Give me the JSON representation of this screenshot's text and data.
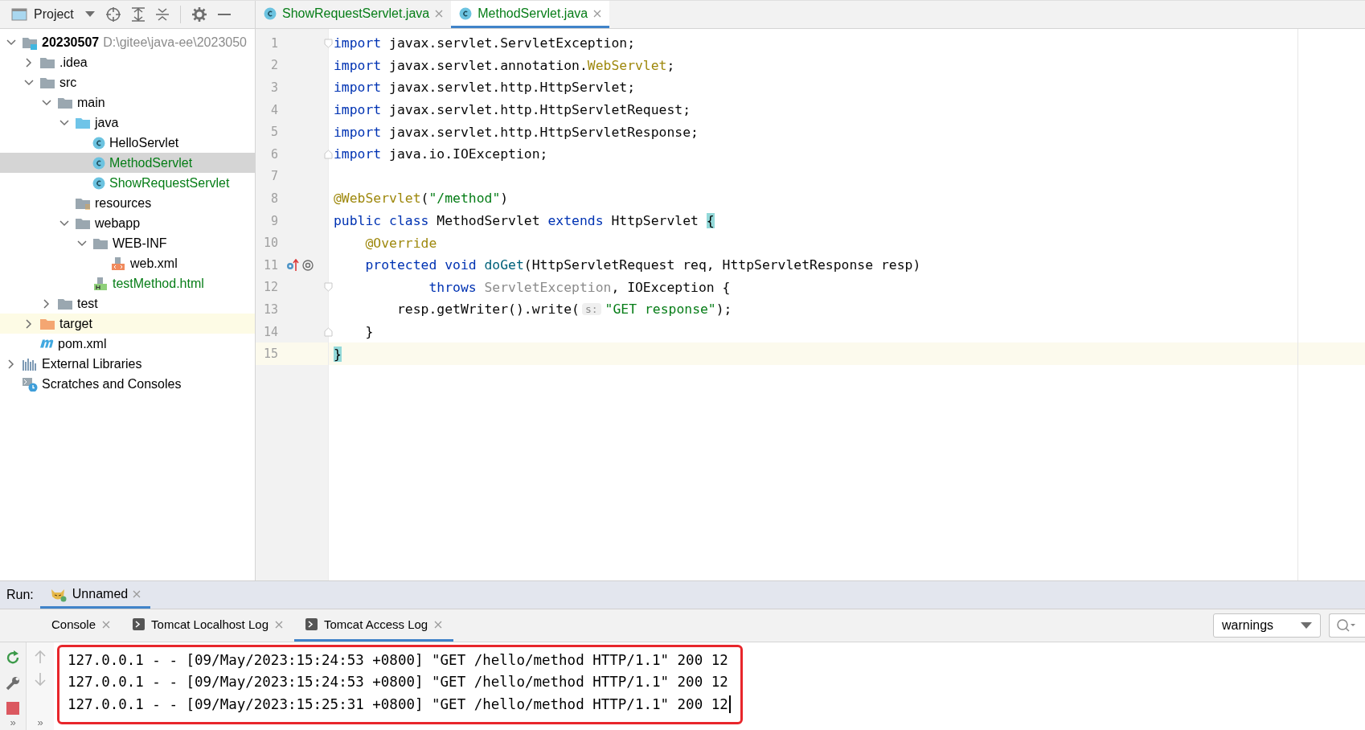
{
  "project_toolbar": {
    "title": "Project"
  },
  "editor_tabs": [
    {
      "label": "ShowRequestServlet.java",
      "selected": false,
      "color": "#067d17"
    },
    {
      "label": "MethodServlet.java",
      "selected": true,
      "color": "#067d17"
    }
  ],
  "tree": [
    {
      "name": "20230507",
      "path": "D:\\gitee\\java-ee\\2023050",
      "kind": "module",
      "expanded": true,
      "selected": false,
      "color": "#000000",
      "children": [
        {
          "name": ".idea",
          "kind": "folder",
          "expanded": false,
          "selected": false,
          "color": "#000000"
        },
        {
          "name": "src",
          "kind": "folder",
          "expanded": true,
          "selected": false,
          "color": "#000000",
          "children": [
            {
              "name": "main",
              "kind": "folder",
              "expanded": true,
              "selected": false,
              "color": "#000000",
              "children": [
                {
                  "name": "java",
                  "kind": "source-folder",
                  "expanded": true,
                  "selected": false,
                  "color": "#000000",
                  "children": [
                    {
                      "name": "HelloServlet",
                      "kind": "class",
                      "selected": false,
                      "color": "#000000"
                    },
                    {
                      "name": "MethodServlet",
                      "kind": "class",
                      "selected": true,
                      "color": "#067d17"
                    },
                    {
                      "name": "ShowRequestServlet",
                      "kind": "class",
                      "selected": false,
                      "color": "#067d17"
                    }
                  ]
                },
                {
                  "name": "resources",
                  "kind": "resources-folder",
                  "selected": false,
                  "color": "#000000"
                },
                {
                  "name": "webapp",
                  "kind": "folder",
                  "expanded": true,
                  "selected": false,
                  "color": "#000000",
                  "children": [
                    {
                      "name": "WEB-INF",
                      "kind": "folder",
                      "expanded": true,
                      "selected": false,
                      "color": "#000000",
                      "children": [
                        {
                          "name": "web.xml",
                          "kind": "xml",
                          "selected": false,
                          "color": "#000000"
                        }
                      ]
                    },
                    {
                      "name": "testMethod.html",
                      "kind": "html",
                      "selected": false,
                      "color": "#067d17"
                    }
                  ]
                }
              ]
            },
            {
              "name": "test",
              "kind": "folder",
              "expanded": false,
              "selected": false,
              "color": "#000000"
            }
          ]
        },
        {
          "name": "target",
          "kind": "excluded-folder",
          "expanded": false,
          "selected": false,
          "color": "#000000"
        },
        {
          "name": "pom.xml",
          "kind": "maven",
          "selected": false,
          "color": "#000000"
        }
      ]
    },
    {
      "name": "External Libraries",
      "kind": "libraries",
      "expanded": false,
      "selected": false,
      "color": "#000000"
    },
    {
      "name": "Scratches and Consoles",
      "kind": "scratches",
      "selected": false,
      "color": "#000000"
    }
  ],
  "code": [
    {
      "number": "1",
      "fold_start": true,
      "tokens": [
        {
          "kind": "kw",
          "t": "import"
        },
        {
          "kind": "plain",
          "t": " javax.servlet.ServletException;"
        }
      ]
    },
    {
      "number": "2",
      "tokens": [
        {
          "kind": "kw",
          "t": "import"
        },
        {
          "kind": "plain",
          "t": " javax.servlet.annotation."
        },
        {
          "kind": "ann",
          "t": "WebServlet"
        },
        {
          "kind": "plain",
          "t": ";"
        }
      ]
    },
    {
      "number": "3",
      "tokens": [
        {
          "kind": "kw",
          "t": "import"
        },
        {
          "kind": "plain",
          "t": " javax.servlet.http.HttpServlet;"
        }
      ]
    },
    {
      "number": "4",
      "tokens": [
        {
          "kind": "kw",
          "t": "import"
        },
        {
          "kind": "plain",
          "t": " javax.servlet.http.HttpServletRequest;"
        }
      ]
    },
    {
      "number": "5",
      "tokens": [
        {
          "kind": "kw",
          "t": "import"
        },
        {
          "kind": "plain",
          "t": " javax.servlet.http.HttpServletResponse;"
        }
      ]
    },
    {
      "number": "6",
      "fold_end": true,
      "tokens": [
        {
          "kind": "kw",
          "t": "import"
        },
        {
          "kind": "plain",
          "t": " java.io.IOException;"
        }
      ]
    },
    {
      "number": "7"
    },
    {
      "number": "8",
      "tokens": [
        {
          "kind": "ann",
          "t": "@WebServlet"
        },
        {
          "kind": "plain",
          "t": "("
        },
        {
          "kind": "str",
          "t": "\"/method\""
        },
        {
          "kind": "plain",
          "t": ")"
        }
      ]
    },
    {
      "number": "9",
      "tokens": [
        {
          "kind": "kw",
          "t": "public class"
        },
        {
          "kind": "plain",
          "t": " MethodServlet "
        },
        {
          "kind": "kw",
          "t": "extends"
        },
        {
          "kind": "plain",
          "t": " HttpServlet "
        },
        {
          "kind": "brace",
          "t": "{"
        }
      ]
    },
    {
      "number": "10",
      "tokens": [
        {
          "kind": "ann",
          "t": "    @Override"
        }
      ]
    },
    {
      "number": "11",
      "override_marker": true,
      "tokens": [
        {
          "kind": "kw",
          "t": "    protected void"
        },
        {
          "kind": "method",
          "t": " doGet"
        },
        {
          "kind": "plain",
          "t": "(HttpServletRequest req, HttpServletResponse resp)"
        }
      ]
    },
    {
      "number": "12",
      "fold_start": true,
      "tokens": [
        {
          "kind": "kw",
          "t": "            throws"
        },
        {
          "kind": "unused",
          "t": " ServletException"
        },
        {
          "kind": "plain",
          "t": ", IOException {"
        }
      ]
    },
    {
      "number": "13",
      "tokens": [
        {
          "kind": "plain",
          "t": "        resp.getWriter().write("
        },
        {
          "kind": "hint",
          "t": "s:"
        },
        {
          "kind": "str",
          "t": "\"GET response\""
        },
        {
          "kind": "plain",
          "t": ");"
        }
      ]
    },
    {
      "number": "14",
      "fold_end": true,
      "tokens": [
        {
          "kind": "plain",
          "t": "    }"
        }
      ]
    },
    {
      "number": "15",
      "current": true,
      "tokens": [
        {
          "kind": "brace",
          "t": "}"
        }
      ]
    }
  ],
  "run_bar": {
    "label": "Run:",
    "tabs": [
      {
        "label": "Unnamed",
        "selected": true
      }
    ]
  },
  "tool_tabs": [
    {
      "label": "Console",
      "kind": "plain",
      "selected": false
    },
    {
      "label": "Tomcat Localhost Log",
      "kind": "log",
      "selected": false
    },
    {
      "label": "Tomcat Access Log",
      "kind": "log",
      "selected": true
    }
  ],
  "filter": {
    "value": "warnings"
  },
  "log_lines": [
    "127.0.0.1 - - [09/May/2023:15:24:53 +0800] \"GET /hello/method HTTP/1.1\" 200 12",
    "127.0.0.1 - - [09/May/2023:15:24:53 +0800] \"GET /hello/method HTTP/1.1\" 200 12",
    "127.0.0.1 - - [09/May/2023:15:25:31 +0800] \"GET /hello/method HTTP/1.1\" 200 12"
  ],
  "more_left": "»",
  "more_right": "»"
}
